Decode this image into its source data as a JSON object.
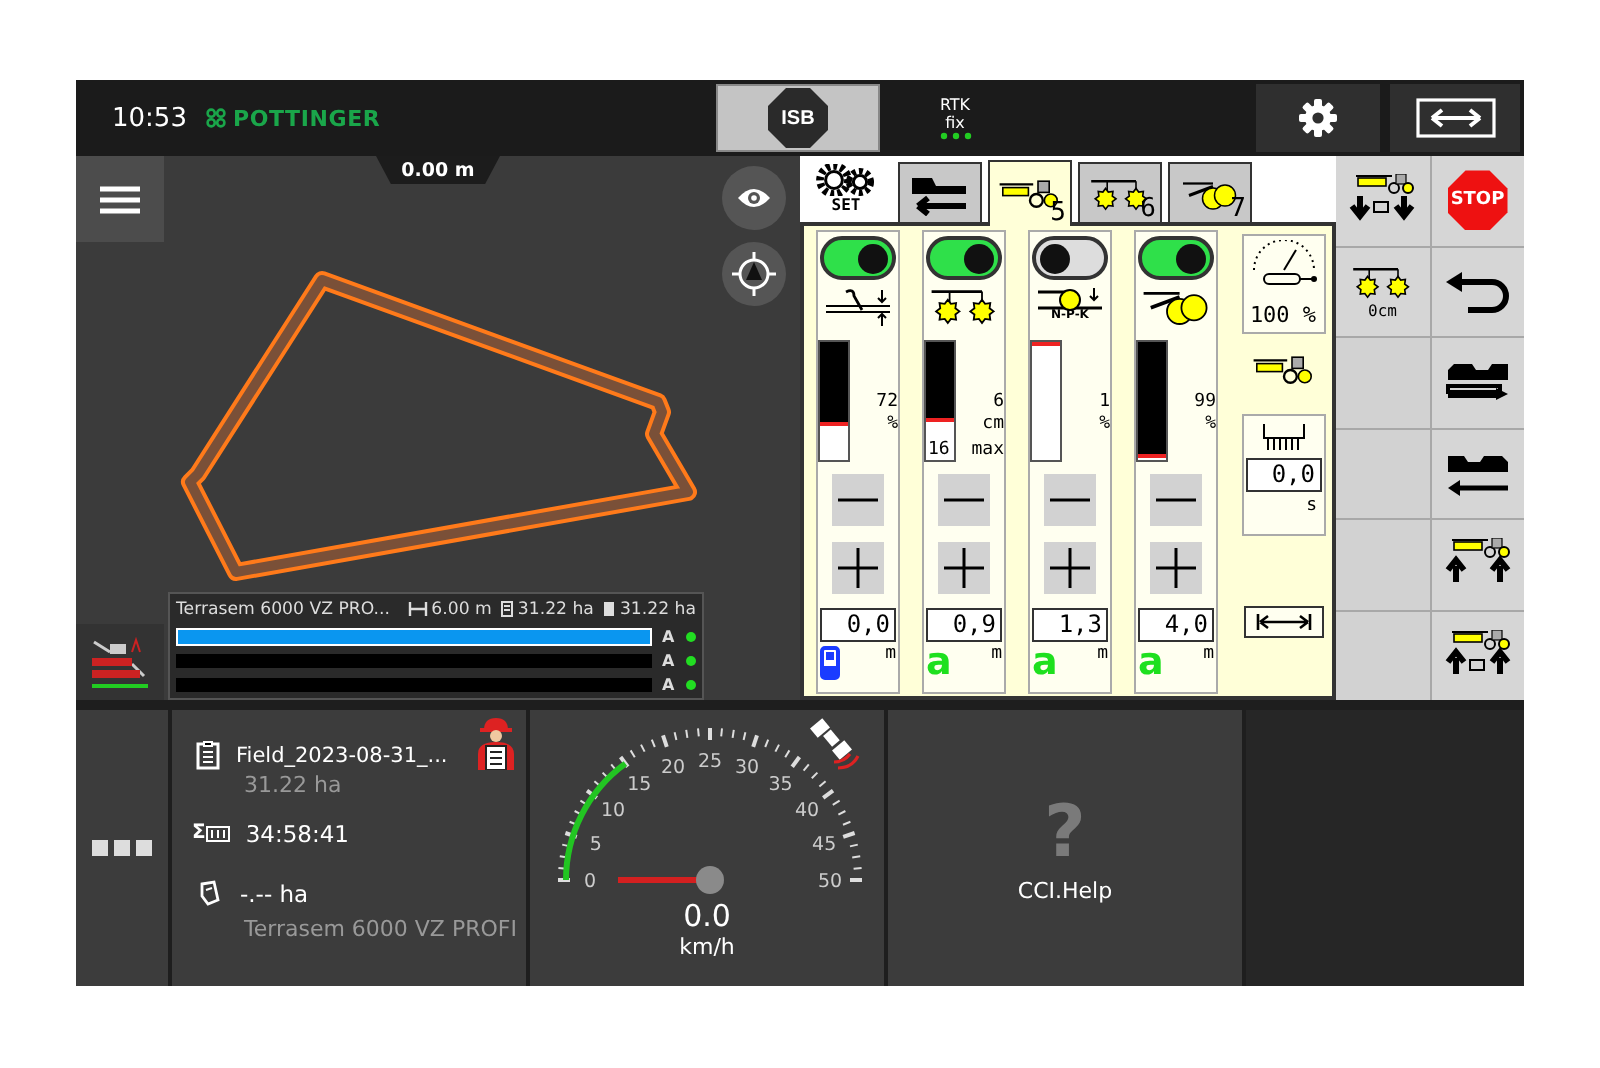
{
  "top_bar": {
    "time": "10:53",
    "brand": "POTTINGER",
    "isb_button": "ISB",
    "rtk": {
      "line_1": "RTK",
      "line_2": "fix"
    }
  },
  "map": {
    "distance": "0.00 m",
    "implement": {
      "name": "Terrasem 6000 VZ PRO...",
      "working_width": "6.00 m",
      "area_total": "31.22 ha",
      "area_worked": "31.22 ha"
    },
    "sections": [
      {
        "active": true,
        "mode": "A"
      },
      {
        "active": false,
        "mode": "A"
      },
      {
        "active": false,
        "mode": "A"
      }
    ]
  },
  "isobus": {
    "tabs": [
      {
        "kind": "settings",
        "label": "SET",
        "selected": false
      },
      {
        "kind": "return",
        "selected": false
      },
      {
        "kind": "implement",
        "label": "5",
        "selected": true
      },
      {
        "kind": "coulters",
        "label": "6",
        "selected": false
      },
      {
        "kind": "discs",
        "label": "7",
        "selected": false
      }
    ],
    "columns": [
      {
        "on": true,
        "kind": "harrow",
        "level": 0.72,
        "reading": "72",
        "unit": "%",
        "value": "0,0",
        "value_unit": "m",
        "mode": {
          "kind": "manual"
        }
      },
      {
        "on": true,
        "kind": "coulters",
        "level": 0.67,
        "reading": "6",
        "unit": "cm",
        "scale_min": "16",
        "scale_note": "max",
        "value": "0,9",
        "value_unit": "m",
        "mode": {
          "kind": "auto",
          "label": "a"
        }
      },
      {
        "on": false,
        "kind": "fertiliser",
        "icon_label": "N-P-K",
        "level": 0.01,
        "reading": "1",
        "unit": "%",
        "value": "1,3",
        "value_unit": "m",
        "mode": {
          "kind": "auto",
          "label": "a"
        }
      },
      {
        "on": true,
        "kind": "press",
        "level": 0.99,
        "reading": "99",
        "unit": "%",
        "value": "4,0",
        "value_unit": "m",
        "mode": {
          "kind": "auto",
          "label": "a"
        }
      }
    ],
    "pressure": {
      "reading": "100 %"
    },
    "delay": {
      "value": "0,0",
      "unit": "s"
    }
  },
  "softkeys": [
    {
      "kind": "lower"
    },
    {
      "kind": "stop",
      "label": "STOP"
    },
    {
      "kind": "coulter-depth",
      "label": "0cm"
    },
    {
      "kind": "back"
    },
    {
      "kind": "empty"
    },
    {
      "kind": "fold-right"
    },
    {
      "kind": "empty"
    },
    {
      "kind": "fold-left"
    },
    {
      "kind": "empty"
    },
    {
      "kind": "raise"
    },
    {
      "kind": "empty"
    },
    {
      "kind": "raise-memory"
    }
  ],
  "bottom": {
    "field": {
      "name": "Field_2023-08-31_...",
      "area": "31.22 ha",
      "time_symbol": "Σ",
      "time": "34:58:41",
      "worked_area": "-.-- ha",
      "machine": "Terrasem 6000 VZ PROFI"
    },
    "speedometer": {
      "labels": [
        "0",
        "5",
        "10",
        "15",
        "20",
        "25",
        "30",
        "35",
        "40",
        "45",
        "50"
      ],
      "level": 0,
      "value": "0.0",
      "unit": "km/h"
    },
    "help": {
      "symbol": "?",
      "label": "CCI.Help"
    }
  }
}
